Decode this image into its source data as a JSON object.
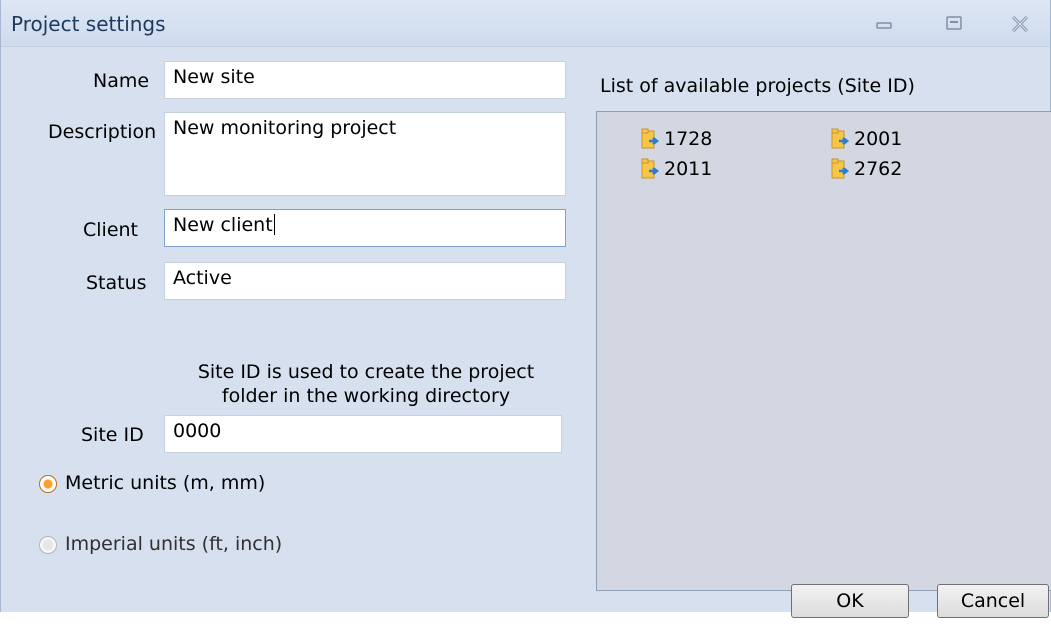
{
  "window": {
    "title": "Project settings"
  },
  "form": {
    "name_label": "Name",
    "name_value": "New site",
    "description_label": "Description",
    "description_value": "New monitoring project",
    "client_label": "Client",
    "client_value": "New client",
    "status_label": "Status",
    "status_value": "Active",
    "site_note_line1": "Site ID is used to create the project",
    "site_note_line2": "folder in the working directory",
    "site_id_label": "Site ID",
    "site_id_value": "0000",
    "metric_label": "Metric units (m, mm)",
    "imperial_label": "Imperial units (ft, inch)",
    "selected_units": "metric"
  },
  "projects": {
    "header": "List of available projects (Site ID)",
    "items": [
      "1728",
      "2001",
      "2011",
      "2762"
    ]
  },
  "buttons": {
    "ok": "OK",
    "cancel": "Cancel"
  },
  "colors": {
    "accent_radio": "#ff9d2a",
    "folder": "#f6c54a",
    "arrow": "#2a7fd4"
  }
}
